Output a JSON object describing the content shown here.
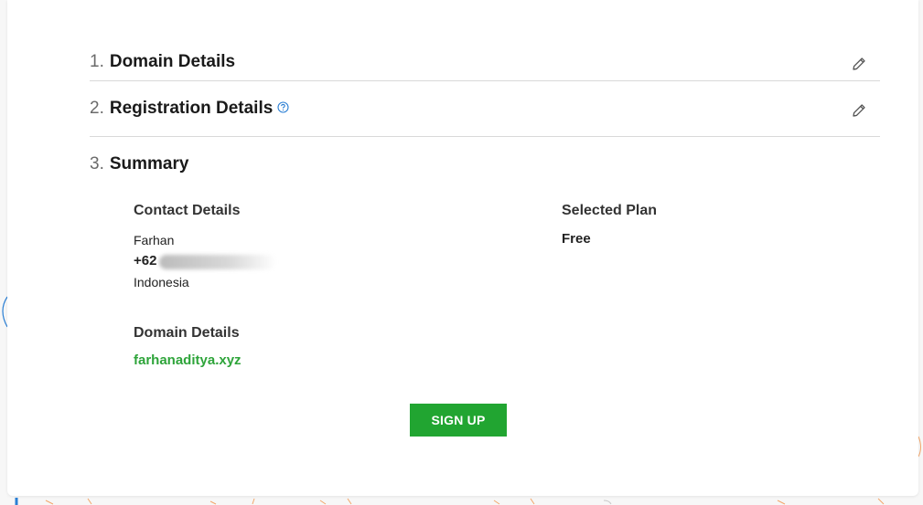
{
  "steps": [
    {
      "number": "1.",
      "title": "Domain Details"
    },
    {
      "number": "2.",
      "title": "Registration Details"
    },
    {
      "number": "3.",
      "title": "Summary"
    }
  ],
  "summary": {
    "contact": {
      "label": "Contact Details",
      "name": "Farhan",
      "phone_prefix": "+62",
      "country": "Indonesia"
    },
    "plan": {
      "label": "Selected Plan",
      "value": "Free"
    },
    "domain": {
      "label": "Domain Details",
      "value": "farhanaditya.xyz"
    }
  },
  "signup_label": "SIGN UP",
  "colors": {
    "accent_green": "#21a531",
    "link_green": "#2ea43a",
    "help_icon_blue": "#2b7fd4",
    "background_deco": "#f2a66a"
  },
  "icons": {
    "edit": "pencil-icon",
    "help": "question-circle-icon"
  }
}
